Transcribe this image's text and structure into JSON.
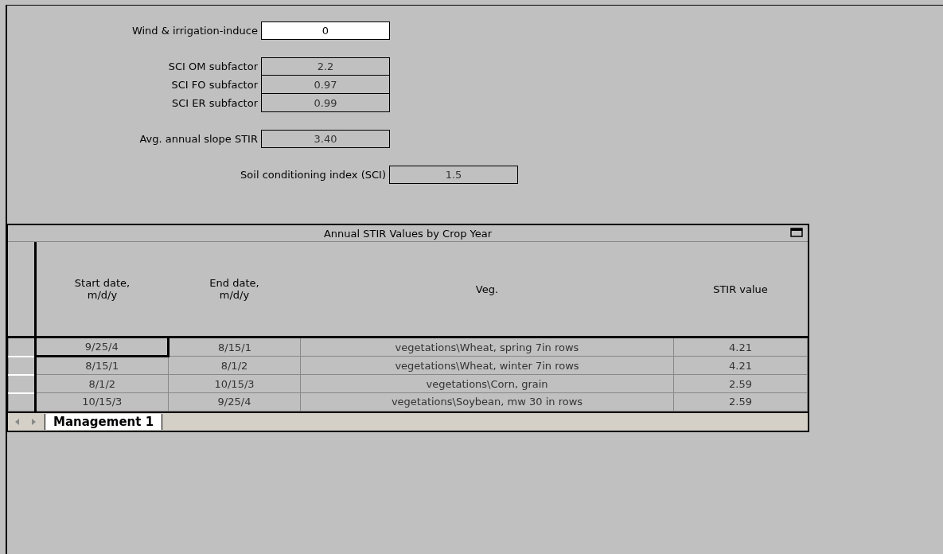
{
  "field_groups": [
    [
      {
        "label": "Wind & irrigation-induce",
        "value": "0",
        "kind": "editable"
      }
    ],
    [
      {
        "label": "SCI OM subfactor",
        "value": "2.2",
        "kind": "readonly"
      },
      {
        "label": "SCI FO subfactor",
        "value": "0.97",
        "kind": "readonly"
      },
      {
        "label": "SCI ER subfactor",
        "value": "0.99",
        "kind": "readonly"
      }
    ],
    [
      {
        "label": "Avg. annual slope STIR",
        "value": "3.40",
        "kind": "readonly"
      }
    ],
    [
      {
        "label": "Soil conditioning index (SCI)",
        "value": "1.5",
        "kind": "readonly"
      }
    ]
  ],
  "table": {
    "title": "Annual STIR Values by Crop Year",
    "columns": [
      "Start date,\nm/d/y",
      "End date,\nm/d/y",
      "Veg.",
      "STIR value"
    ],
    "rows": [
      {
        "cells": [
          "9/25/4",
          "8/15/1",
          "vegetations\\Wheat, spring 7in rows",
          "4.21"
        ],
        "selected": true
      },
      {
        "cells": [
          "8/15/1",
          "8/1/2",
          "vegetations\\Wheat, winter 7in rows",
          "4.21"
        ],
        "selected": false
      },
      {
        "cells": [
          "8/1/2",
          "10/15/3",
          "vegetations\\Corn, grain",
          "2.59"
        ],
        "selected": false
      },
      {
        "cells": [
          "10/15/3",
          "9/25/4",
          "vegetations\\Soybean, mw 30 in rows",
          "2.59"
        ],
        "selected": false
      }
    ],
    "sheet_tabs": [
      {
        "label": "Management 1",
        "selected": true
      }
    ]
  }
}
